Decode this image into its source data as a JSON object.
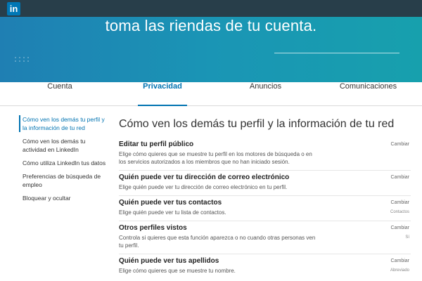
{
  "app": {
    "logo_text": "in"
  },
  "hero": {
    "title": "toma las riendas de tu cuenta."
  },
  "tabs": [
    {
      "label": "Cuenta",
      "active": false
    },
    {
      "label": "Privacidad",
      "active": true
    },
    {
      "label": "Anuncios",
      "active": false
    },
    {
      "label": "Comunicaciones",
      "active": false
    }
  ],
  "sidebar": {
    "items": [
      {
        "label": "Cómo ven los demás tu perfil y la información de tu red",
        "active": true
      },
      {
        "label": "Cómo ven los demás tu actividad en LinkedIn",
        "active": false
      },
      {
        "label": "Cómo utiliza LinkedIn tus datos",
        "active": false
      },
      {
        "label": "Preferencias de búsqueda de empleo",
        "active": false
      },
      {
        "label": "Bloquear y ocultar",
        "active": false
      }
    ]
  },
  "main": {
    "title": "Cómo ven los demás tu perfil y la información de tu red",
    "settings": [
      {
        "title": "Editar tu perfil público",
        "description": "Elige cómo quieres que se muestre tu perfil en los motores de búsqueda o en los servicios autorizados a los miembros que no han iniciado sesión.",
        "action": "Cambiar",
        "value": ""
      },
      {
        "title": "Quién puede ver tu dirección de correo electrónico",
        "description": "Elige quién puede ver tu dirección de correo electrónico en tu perfil.",
        "action": "Cambiar",
        "value": ""
      },
      {
        "title": "Quién puede ver tus contactos",
        "description": "Elige quién puede ver tu lista de contactos.",
        "action": "Cambiar",
        "value": "Contactos"
      },
      {
        "title": "Otros perfiles vistos",
        "description": "Controla si quieres que esta función aparezca o no cuando otras personas ven tu perfil.",
        "action": "Cambiar",
        "value": "Sí"
      },
      {
        "title": "Quién puede ver tus apellidos",
        "description": "Elige cómo quieres que se muestre tu nombre.",
        "action": "Cambiar",
        "value": "Abreviado"
      }
    ]
  },
  "colors": {
    "accent": "#0073b1",
    "topbar": "#283e4a",
    "hero_start": "#1f7fb3",
    "hero_end": "#17a0ad"
  }
}
